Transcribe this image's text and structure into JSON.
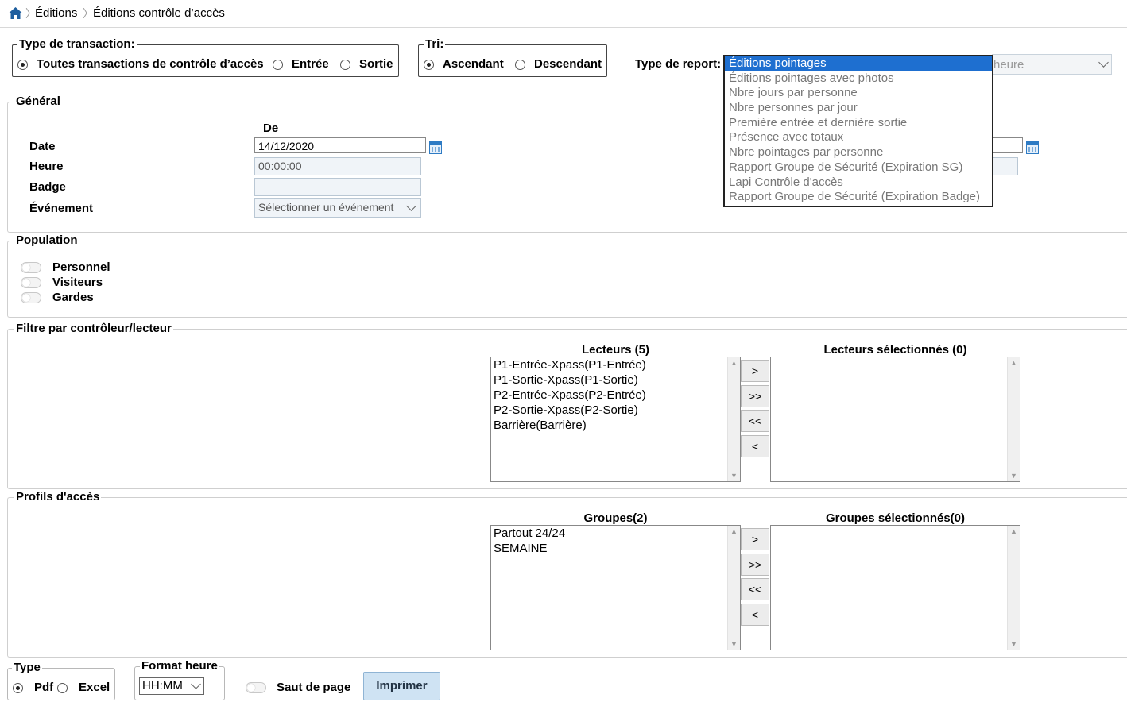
{
  "breadcrumb": {
    "home": "home-icon",
    "items": [
      "Éditions",
      "Éditions contrôle d’accès"
    ]
  },
  "transaction": {
    "legend": "Type de transaction:",
    "options": [
      "Toutes transactions de contrôle d’accès",
      "Entrée",
      "Sortie"
    ],
    "selected": "Toutes transactions de contrôle d’accès"
  },
  "tri": {
    "legend": "Tri:",
    "options": [
      "Ascendant",
      "Descendant"
    ],
    "selected": "Ascendant"
  },
  "report": {
    "label": "Type de report:",
    "partial_value": "heure",
    "options": [
      "Éditions pointages",
      "Éditions pointages avec photos",
      "Nbre jours par personne",
      "Nbre personnes par jour",
      "Première entrée et dernière sortie",
      "Présence avec totaux",
      "Nbre pointages par personne",
      "Rapport Groupe de Sécurité (Expiration SG)",
      "Lapi Contrôle d'accès",
      "Rapport Groupe de Sécurité (Expiration Badge)"
    ],
    "selected": "Éditions pointages"
  },
  "general": {
    "legend": "Général",
    "col_de": "De",
    "date_label": "Date",
    "date_value": "14/12/2020",
    "heure_label": "Heure",
    "heure_value": "00:00:00",
    "badge_label": "Badge",
    "badge_value": "",
    "event_label": "Événement",
    "event_placeholder": "Sélectionner un événement"
  },
  "population": {
    "legend": "Population",
    "items": [
      "Personnel",
      "Visiteurs",
      "Gardes"
    ]
  },
  "filtre": {
    "legend": "Filtre par contrôleur/lecteur",
    "available_title": "Lecteurs (5)",
    "selected_title": "Lecteurs sélectionnés (0)",
    "available": [
      "P1-Entrée-Xpass(P1-Entrée)",
      "P1-Sortie-Xpass(P1-Sortie)",
      "P2-Entrée-Xpass(P2-Entrée)",
      "P2-Sortie-Xpass(P2-Sortie)",
      "Barrière(Barrière)"
    ],
    "buttons": [
      ">",
      ">>",
      "<<",
      "<"
    ]
  },
  "profils": {
    "legend": "Profils d'accès",
    "available_title": "Groupes(2)",
    "selected_title": "Groupes sélectionnés(0)",
    "available": [
      "Partout 24/24",
      "SEMAINE"
    ],
    "buttons": [
      ">",
      ">>",
      "<<",
      "<"
    ]
  },
  "footer": {
    "type_legend": "Type",
    "type_options": [
      "Pdf",
      "Excel"
    ],
    "type_selected": "Pdf",
    "format_legend": "Format heure",
    "format_value": "HH:MM",
    "saut_label": "Saut de page",
    "print_label": "Imprimer"
  },
  "colors": {
    "accent": "#1e6fd0",
    "home": "#1f5f9f",
    "print_bg": "#cfe3f3"
  }
}
